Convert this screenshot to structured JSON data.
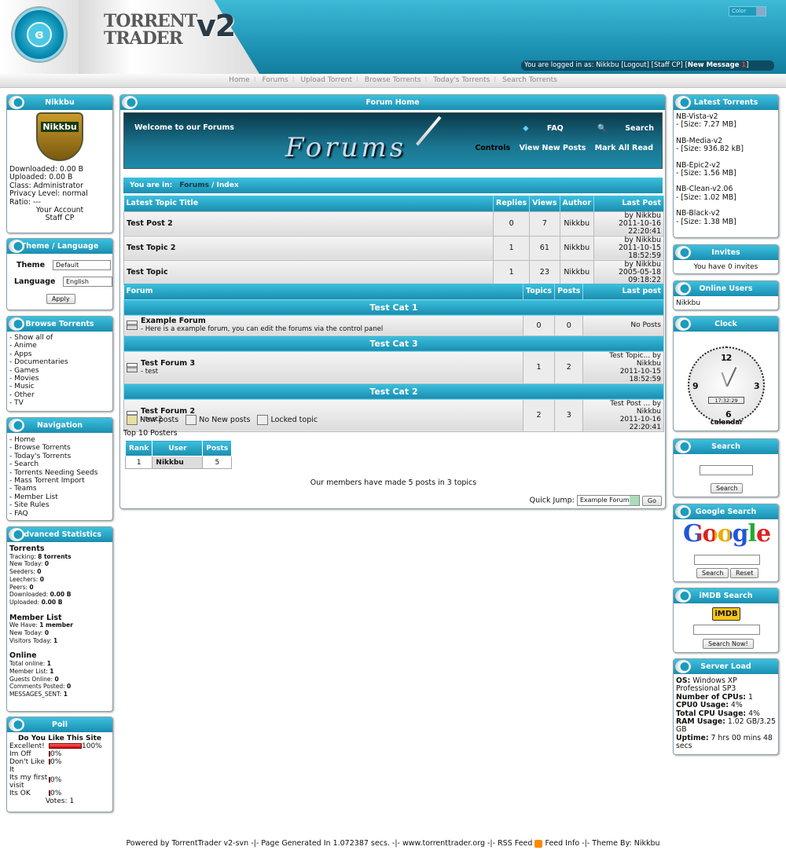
{
  "header": {
    "logo_text": "TORRENT TRADER",
    "logo_version": "v2",
    "color_select": "Color",
    "login_prefix": "You are logged in as:",
    "username": "Nikkbu",
    "logout": "Logout",
    "staff_cp": "Staff CP",
    "new_message": "New Message",
    "new_count": "1"
  },
  "nav": [
    "Home",
    "Forums",
    "Upload Torrent",
    "Browse Torrents",
    "Today's Torrents",
    "Search Torrents"
  ],
  "user_box": {
    "title": "Nikkbu",
    "avatar_text": "Nikkbu",
    "downloaded": "Downloaded: 0.00 B",
    "uploaded": "Uploaded: 0.00 B",
    "class": "Class: Administrator",
    "privacy": "Privacy Level: normal",
    "ratio": "Ratio: ---",
    "your_account": "Your Account",
    "staff_cp": "Staff CP"
  },
  "theme_box": {
    "title": "Theme / Language",
    "theme_label": "Theme",
    "theme_value": "Default",
    "lang_label": "Language",
    "lang_value": "English",
    "apply": "Apply"
  },
  "browse_box": {
    "title": "Browse Torrents",
    "items": [
      "- Show all of",
      "- Anime",
      "- Apps",
      "- Documentaries",
      "- Games",
      "- Movies",
      "- Music",
      "- Other",
      "- TV"
    ]
  },
  "nav_box": {
    "title": "Navigation",
    "items": [
      "- Home",
      "- Browse Torrents",
      "- Today's Torrents",
      "- Search",
      "- Torrents Needing Seeds",
      "- Mass Torrent Import",
      "- Teams",
      "- Member List",
      "- Site Rules",
      "- FAQ"
    ]
  },
  "stats_box": {
    "title": "Advanced Statistics",
    "torrents_h": "Torrents",
    "tracking_l": "Tracking:",
    "tracking_v": "8 torrents",
    "newtoday_l": "New Today:",
    "newtoday_v": "0",
    "seeders_l": "Seeders:",
    "seeders_v": "0",
    "leechers_l": "Leechers:",
    "leechers_v": "0",
    "peers_l": "Peers:",
    "peers_v": "0",
    "down_l": "Downloaded:",
    "down_v": "0.00 B",
    "up_l": "Uploaded:",
    "up_v": "0.00 B",
    "members_h": "Member List",
    "wehave_l": "We Have:",
    "wehave_v": "1 member",
    "mnew_l": "New Today:",
    "mnew_v": "0",
    "visitors_l": "Visitors Today:",
    "visitors_v": "1",
    "online_h": "Online",
    "total_l": "Total online:",
    "total_v": "1",
    "mlist_l": "Member List:",
    "mlist_v": "1",
    "guests_l": "Guests Online:",
    "guests_v": "0",
    "comments_l": "Comments Posted:",
    "comments_v": "0",
    "msgs_l": "MESSAGES_SENT:",
    "msgs_v": "1"
  },
  "poll_box": {
    "title": "Poll",
    "question": "Do You Like This Site",
    "options": [
      {
        "label": "Excellent!",
        "pct": "100%",
        "value": 1.0
      },
      {
        "label": "Im Off",
        "pct": "0%",
        "value": 0
      },
      {
        "label": "Don't Like It",
        "pct": "0%",
        "value": 0
      },
      {
        "label": "Its my first visit",
        "pct": "0%",
        "value": 0
      },
      {
        "label": "Its OK",
        "pct": "0%",
        "value": 0
      }
    ],
    "votes": "Votes: 1"
  },
  "main": {
    "title": "Forum Home",
    "welcome": "Welcome to our Forums",
    "banner_title": "Forums",
    "faq": "FAQ",
    "search": "Search",
    "controls": "Controls",
    "view_new": "View New Posts",
    "mark_all": "Mark All Read",
    "you_are_in": "You are in:",
    "crumb_forums": "Forums",
    "crumb_index": "Index"
  },
  "latest_topics": {
    "headers": [
      "Latest Topic Title",
      "Replies",
      "Views",
      "Author",
      "Last Post"
    ],
    "rows": [
      {
        "title": "Test Post 2",
        "replies": "0",
        "views": "7",
        "author": "Nikkbu",
        "by": "by Nikkbu",
        "date": "2011-10-16 22:20:41"
      },
      {
        "title": "Test Topic 2",
        "replies": "1",
        "views": "61",
        "author": "Nikkbu",
        "by": "by Nikkbu",
        "date": "2011-10-15 18:52:59"
      },
      {
        "title": "Test Topic",
        "replies": "1",
        "views": "23",
        "author": "Nikkbu",
        "by": "by Nikkbu",
        "date": "2005-05-18 09:18:22"
      }
    ]
  },
  "forums": {
    "headers": [
      "Forum",
      "Topics",
      "Posts",
      "Last post"
    ],
    "cats": [
      {
        "name": "Test Cat 1",
        "forum": "Example Forum",
        "desc": "- Here is a example forum, you can edit the forums via the control panel",
        "topics": "0",
        "posts": "0",
        "last1": "No Posts",
        "last2": ""
      },
      {
        "name": "Test Cat 3",
        "forum": "Test Forum 3",
        "desc": "- test",
        "topics": "1",
        "posts": "2",
        "last1": "Test Topic... by Nikkbu",
        "last2": "2011-10-15 18:52:59"
      },
      {
        "name": "Test Cat 2",
        "forum": "Test Forum 2",
        "desc": "- test2",
        "topics": "2",
        "posts": "3",
        "last1": "Test Post ... by Nikkbu",
        "last2": "2011-10-16 22:20:41"
      }
    ]
  },
  "legend": {
    "new": "New posts",
    "nonew": "No New posts",
    "locked": "Locked topic"
  },
  "posters": {
    "title": "Top 10 Posters",
    "headers": [
      "Rank",
      "User",
      "Posts"
    ],
    "rank": "1",
    "user": "Nikkbu",
    "posts": "5"
  },
  "members_stat": "Our members have made 5 posts in 3 topics",
  "quickjump": {
    "label": "Quick Jump:",
    "value": "Example Forum",
    "go": "Go"
  },
  "latest_torrents": {
    "title": "Latest Torrents",
    "items": [
      {
        "name": "NB-Vista-v2",
        "size": "- [Size: 7.27 MB]"
      },
      {
        "name": "NB-Media-v2",
        "size": "- [Size: 936.82 kB]"
      },
      {
        "name": "NB-Epic2-v2",
        "size": "- [Size: 1.56 MB]"
      },
      {
        "name": "NB-Clean-v2.06",
        "size": "- [Size: 1.02 MB]"
      },
      {
        "name": "NB-Black-v2",
        "size": "- [Size: 1.38 MB]"
      }
    ]
  },
  "invites": {
    "title": "Invites",
    "text": "You have 0 invites"
  },
  "online": {
    "title": "Online Users",
    "user": "Nikkbu"
  },
  "clock": {
    "title": "Clock",
    "time": "17:32:29",
    "label": "calendar"
  },
  "search_box": {
    "title": "Search",
    "button": "Search"
  },
  "google_box": {
    "title": "Google Search",
    "logo": "Google",
    "search": "Search",
    "reset": "Reset"
  },
  "imdb_box": {
    "title": "iMDB Search",
    "logo": "iMDB",
    "button": "Search Now!"
  },
  "server": {
    "title": "Server Load",
    "os_l": "OS:",
    "os_v": "Windows XP Professional SP3",
    "cpus_l": "Number of CPUs:",
    "cpus_v": "1",
    "cpu0_l": "CPU0 Usage:",
    "cpu0_v": "4%",
    "total_l": "Total CPU Usage:",
    "total_v": "4%",
    "ram_l": "RAM Usage:",
    "ram_v": "1.02 GB/3.25 GB",
    "uptime_l": "Uptime:",
    "uptime_v": "7 hrs 00 mins 48 secs"
  },
  "footer": {
    "t1": "Powered by TorrentTrader v2-svn -|- Page Generated In 1.072387 secs. -|- www.torrenttrader.org -|- RSS Feed",
    "t2": "Feed Info -|- Theme By: Nikkbu"
  },
  "colors": {
    "accent": "#1a8eb0",
    "header": "#3dbad6"
  }
}
